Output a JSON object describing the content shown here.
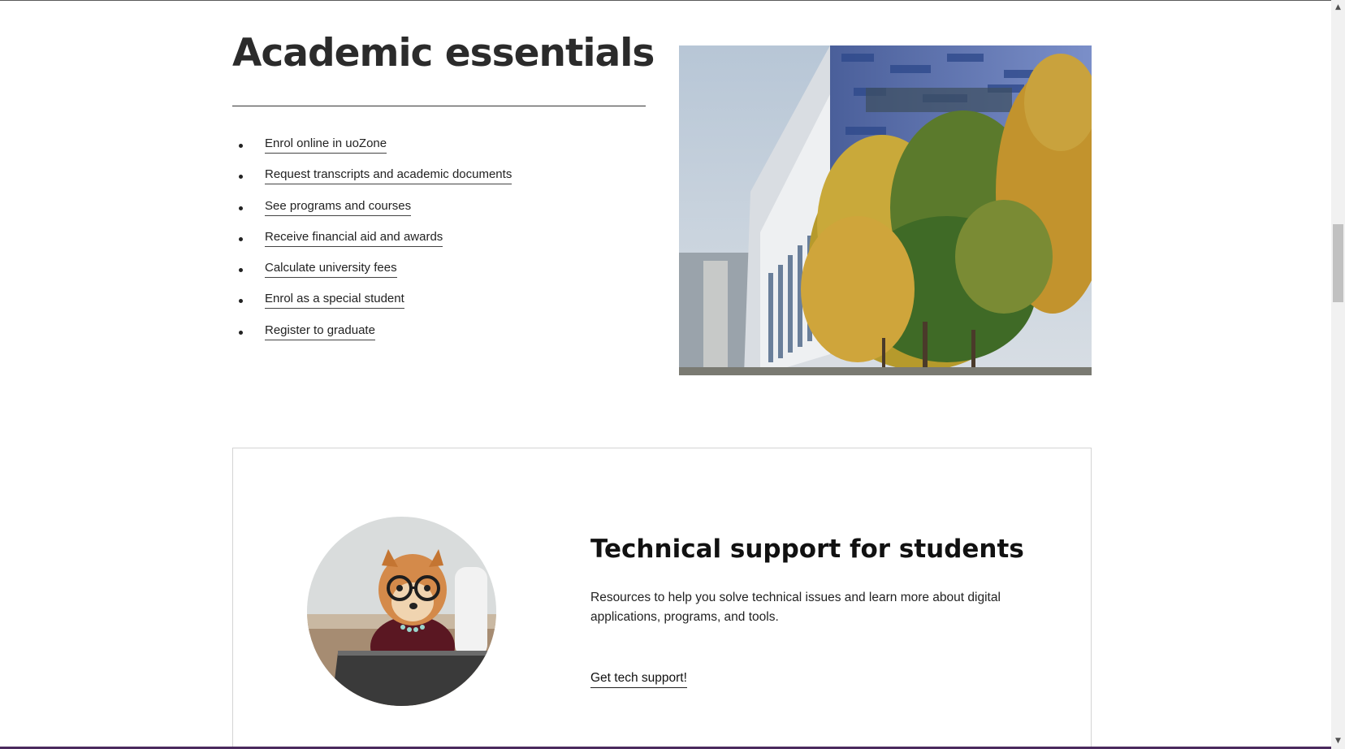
{
  "essentials": {
    "title": "Academic essentials",
    "links": [
      {
        "label": "Enrol online in uoZone"
      },
      {
        "label": "Request transcripts and academic documents"
      },
      {
        "label": "See programs and courses"
      },
      {
        "label": "Receive financial aid and awards"
      },
      {
        "label": "Calculate university fees"
      },
      {
        "label": "Enrol as a special student"
      },
      {
        "label": "Register to graduate"
      }
    ]
  },
  "support": {
    "title": "Technical support for students",
    "description": "Resources to help you solve technical issues and learn more about digital applications, programs, and tools.",
    "link_label": "Get tech support!"
  },
  "icons": {
    "scroll_up": "scroll-up-arrow-icon",
    "scroll_down": "scroll-down-arrow-icon"
  },
  "colors": {
    "text": "#222222",
    "bottom_border": "#4b2a5e"
  }
}
